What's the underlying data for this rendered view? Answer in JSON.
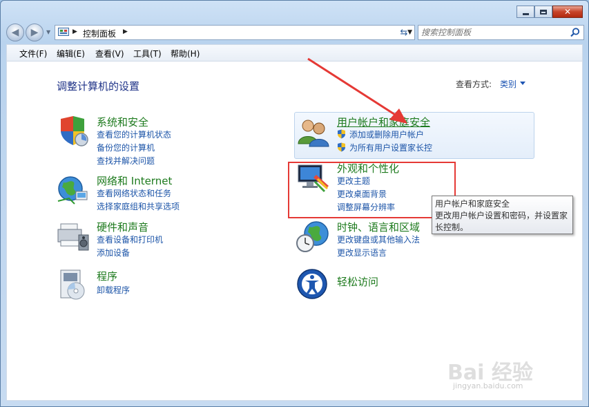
{
  "window": {
    "address_crumb": "控制面板",
    "search_placeholder": "搜索控制面板"
  },
  "menu": [
    "文件(F)",
    "编辑(E)",
    "查看(V)",
    "工具(T)",
    "帮助(H)"
  ],
  "header": {
    "title": "调整计算机的设置",
    "view_by_label": "查看方式:",
    "view_by_value": "类别"
  },
  "categories": {
    "system": {
      "title": "系统和安全",
      "links": [
        "查看您的计算机状态",
        "备份您的计算机",
        "查找并解决问题"
      ]
    },
    "network": {
      "title": "网络和 Internet",
      "links": [
        "查看网络状态和任务",
        "选择家庭组和共享选项"
      ]
    },
    "hardware": {
      "title": "硬件和声音",
      "links": [
        "查看设备和打印机",
        "添加设备"
      ]
    },
    "programs": {
      "title": "程序",
      "links": [
        "卸载程序"
      ]
    },
    "users": {
      "title": "用户帐户和家庭安全",
      "links": [
        "添加或删除用户帐户",
        "为所有用户设置家长控"
      ]
    },
    "appearance": {
      "title": "外观和个性化",
      "links": [
        "更改主题",
        "更改桌面背景",
        "调整屏幕分辨率"
      ]
    },
    "clock": {
      "title": "时钟、语言和区域",
      "links": [
        "更改键盘或其他输入法",
        "更改显示语言"
      ]
    },
    "ease": {
      "title": "轻松访问",
      "links": []
    }
  },
  "tooltip": {
    "line1": "用户帐户和家庭安全",
    "line2": "更改用户帐户设置和密码，并设置家",
    "line3": "长控制。"
  },
  "watermark": {
    "brand": "Bai 经验",
    "url": "jingyan.baidu.com"
  },
  "colors": {
    "category_title": "#1d7a1d",
    "link": "#1d55a8",
    "highlight_box": "#e53935"
  }
}
